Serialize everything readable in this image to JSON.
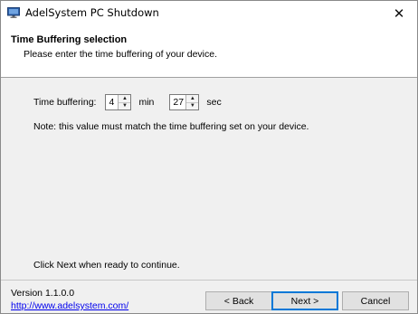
{
  "window": {
    "title": "AdelSystem PC Shutdown",
    "close_glyph": "✕",
    "icon": "monitor-icon"
  },
  "header": {
    "title": "Time Buffering selection",
    "subtitle": "Please enter the time buffering of your device."
  },
  "form": {
    "time_label": "Time buffering:",
    "minutes_value": "4",
    "minutes_unit": "min",
    "seconds_value": "27",
    "seconds_unit": "sec",
    "note": "Note: this value must match the time buffering set on your device.",
    "continue_text": "Click Next when ready to continue."
  },
  "footer": {
    "version": "Version 1.1.0.0",
    "link": "http://www.adelsystem.com/",
    "back_label": "< Back",
    "next_label": "Next >",
    "cancel_label": "Cancel"
  },
  "colors": {
    "link": "#0000ee",
    "default_button_border": "#0078d7",
    "header_bg": "#ffffff",
    "body_bg": "#f0f0f0"
  }
}
